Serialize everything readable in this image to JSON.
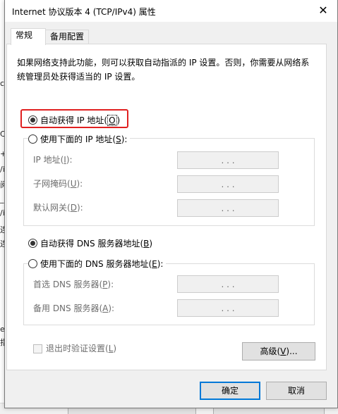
{
  "window": {
    "title": "Internet 协议版本 4 (TCP/IPv4) 属性",
    "close_glyph": "✕"
  },
  "tabs": [
    {
      "label": "常规"
    },
    {
      "label": "备用配置"
    }
  ],
  "description": "如果网络支持此功能，则可以获取自动指派的 IP 设置。否则，你需要从网络系统管理员处获得适当的 IP 设置。",
  "ip": {
    "auto_label": "自动获得 IP 地址(",
    "auto_key": "O",
    "auto_close": ")",
    "manual_label": "使用下面的 IP 地址(",
    "manual_key": "S",
    "manual_close": "):",
    "fields": [
      {
        "label": "IP 地址(",
        "key": "I",
        "suffix": "):",
        "value": ". . ."
      },
      {
        "label": "子网掩码(",
        "key": "U",
        "suffix": "):",
        "value": ". . ."
      },
      {
        "label": "默认网关(",
        "key": "D",
        "suffix": "):",
        "value": ". . ."
      }
    ]
  },
  "dns": {
    "auto_label": "自动获得 DNS 服务器地址(",
    "auto_key": "B",
    "auto_close": ")",
    "manual_label": "使用下面的 DNS 服务器地址(",
    "manual_key": "E",
    "manual_close": "):",
    "fields": [
      {
        "label": "首选 DNS 服务器(",
        "key": "P",
        "suffix": "):",
        "value": ". . ."
      },
      {
        "label": "备用 DNS 服务器(",
        "key": "A",
        "suffix": "):",
        "value": ". . ."
      }
    ]
  },
  "validate": {
    "label": "退出时验证设置(",
    "key": "L",
    "suffix": ")"
  },
  "advanced": {
    "label": "高级(",
    "key": "V",
    "suffix": ")..."
  },
  "footer": {
    "ok": "确定",
    "cancel": "取消"
  },
  "background_fragments": [
    "c",
    "C",
    "+",
    "/i",
    "阅",
    "_C",
    "/i",
    "连",
    "连",
    "er",
    "指"
  ],
  "colors": {
    "highlight": "#e02020",
    "default_button_border": "#0078d7"
  }
}
